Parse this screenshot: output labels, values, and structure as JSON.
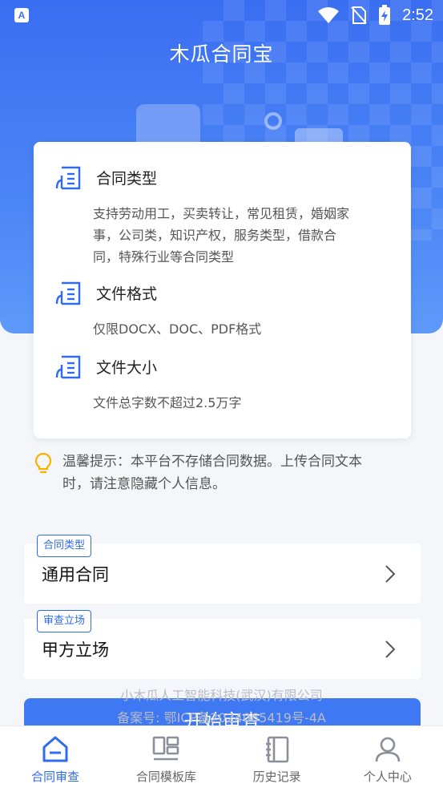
{
  "status_bar": {
    "left_icon": "A",
    "time": "2:52",
    "icons": [
      "wifi-icon",
      "no-sim-icon",
      "battery-charging-icon"
    ]
  },
  "app": {
    "title": "木瓜合同宝"
  },
  "info_card": {
    "sections": [
      {
        "icon": "document-icon",
        "title": "合同类型",
        "lines": [
          "支持劳动用工，买卖转让，常见租赁，婚姻家",
          "事，公司类，知识产权，服务类型，借款合",
          "同，特殊行业等合同类型"
        ]
      },
      {
        "icon": "document-icon",
        "title": "文件格式",
        "lines": [
          "仅限DOCX、DOC、PDF格式"
        ]
      },
      {
        "icon": "document-icon",
        "title": "文件大小",
        "lines": [
          "文件总字数不超过2.5万字"
        ]
      }
    ]
  },
  "tip": {
    "icon": "lightbulb-icon",
    "lines": [
      "温馨提示：本平台不存储合同数据。上传合同文本",
      "时，请注意隐藏个人信息。"
    ]
  },
  "contract_type": {
    "badge": "合同类型",
    "value": "通用合同"
  },
  "review_position": {
    "badge": "审查立场",
    "value": "甲方立场"
  },
  "footer": {
    "company": "小木瓜人工智能科技(武汉)有限公司",
    "icp": "备案号: 鄂ICP备2024065419号-4A"
  },
  "start_button": {
    "label": "开始审查"
  },
  "tabbar": {
    "tabs": [
      {
        "icon": "contract-review-icon",
        "label": "合同审查",
        "active": true
      },
      {
        "icon": "template-library-icon",
        "label": "合同模板库",
        "active": false
      },
      {
        "icon": "history-icon",
        "label": "历史记录",
        "active": false
      },
      {
        "icon": "user-icon",
        "label": "个人中心",
        "active": false
      }
    ]
  },
  "colors": {
    "primary": "#2f6bef",
    "hero": "#3a6ef2",
    "tip_icon": "#f5b400"
  }
}
